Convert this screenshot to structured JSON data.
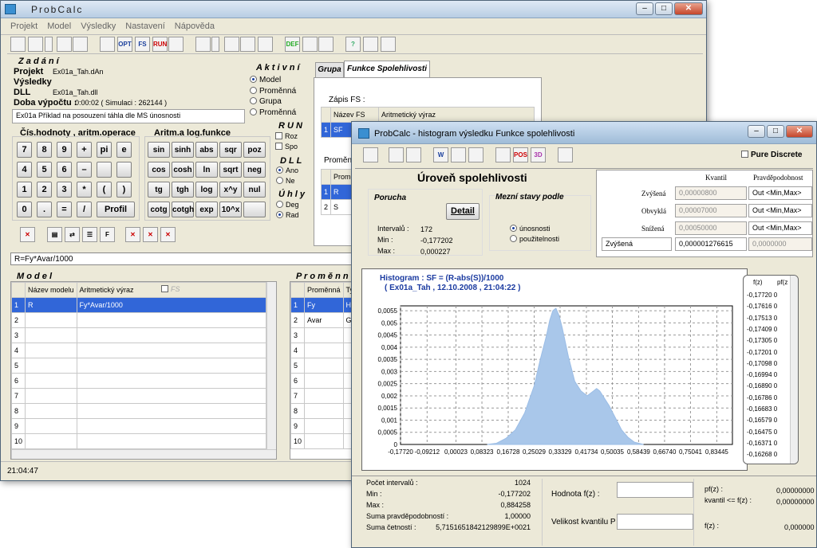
{
  "main": {
    "title": "ProbCalc",
    "menu": [
      "Projekt",
      "Model",
      "Výsledky",
      "Nastavení",
      "Nápověda"
    ],
    "toolbar": [
      "",
      "",
      "",
      "",
      "",
      "",
      "OPT",
      "FS",
      "RUN",
      "",
      "",
      "",
      "",
      "",
      "",
      "DEF",
      "",
      "",
      "?",
      ""
    ],
    "zadani": {
      "heading": "Z a d á n í",
      "projekt_l": "Projekt",
      "projekt_v": "Ex01a_Tah.dAn",
      "vysledky_l": "Výsledky",
      "dll_l": "DLL",
      "dll_v": "Ex01a_Tah.dll",
      "doba_l": "Doba výpočtu :",
      "doba_v": "0:00:02  ( Simulaci : 262144 )",
      "desc": "Ex01a Příklad na posouzení táhla dle MS únosnosti"
    },
    "aktivni": {
      "heading": "A k t i v n í",
      "items": [
        "Model",
        "Proměnná",
        "Grupa",
        "Proměnná"
      ]
    },
    "run": {
      "heading": "R U N",
      "items": [
        "Roz",
        "Spo"
      ]
    },
    "dll": {
      "heading": "D L L",
      "items": [
        "Ano",
        "Ne"
      ]
    },
    "uhly": {
      "heading": "Ú h l y",
      "items": [
        "Deg",
        "Rad"
      ]
    },
    "calc": {
      "heading1": "Čís.hodnoty , aritm.operace",
      "heading2": "Aritm.a log.funkce",
      "rows1": [
        [
          "7",
          "8",
          "9",
          "+",
          "pi",
          "e"
        ],
        [
          "4",
          "5",
          "6",
          "–",
          "",
          ""
        ],
        [
          "1",
          "2",
          "3",
          "*",
          "(",
          ")"
        ],
        [
          "0",
          ".",
          "=",
          "/",
          "Profil"
        ]
      ],
      "rows2": [
        [
          "sin",
          "sinh",
          "abs",
          "sqr",
          "poz"
        ],
        [
          "cos",
          "cosh",
          "ln",
          "sqrt",
          "neg"
        ],
        [
          "tg",
          "tgh",
          "log",
          "x^y",
          "nul"
        ],
        [
          "cotg",
          "cotgh",
          "exp",
          "10^x",
          ""
        ]
      ]
    },
    "formula": "R=Fy*Avar/1000",
    "model": {
      "heading": "M o d e l",
      "cols": [
        "Název modelu",
        "Aritmetický výraz",
        "FS"
      ],
      "rows": [
        [
          "1",
          "R",
          "Fy*Avar/1000"
        ],
        [
          "2",
          "",
          ""
        ],
        [
          "3",
          "",
          ""
        ],
        [
          "4",
          "",
          ""
        ],
        [
          "5",
          "",
          ""
        ],
        [
          "6",
          "",
          ""
        ],
        [
          "7",
          "",
          ""
        ],
        [
          "8",
          "",
          ""
        ],
        [
          "9",
          "",
          ""
        ],
        [
          "10",
          "",
          ""
        ]
      ]
    },
    "promenne": {
      "heading": "P r o m ě n n é",
      "cols": [
        "Proměnná",
        "Typ"
      ],
      "rows": [
        [
          "1",
          "Fy",
          "Histogr"
        ],
        [
          "2",
          "Avar",
          "Grupa"
        ],
        [
          "3",
          "",
          ""
        ],
        [
          "4",
          "",
          ""
        ],
        [
          "5",
          "",
          ""
        ],
        [
          "6",
          "",
          ""
        ],
        [
          "7",
          "",
          ""
        ],
        [
          "8",
          "",
          ""
        ],
        [
          "9",
          "",
          ""
        ],
        [
          "10",
          "",
          ""
        ]
      ]
    },
    "tabs": [
      "Grupa",
      "Funkce Spolehlivosti"
    ],
    "fs": {
      "zapis": "Zápis FS :",
      "cols": [
        "Název FS",
        "Aritmetický výraz"
      ],
      "row": [
        "1",
        "SF"
      ],
      "prom": "Proměnná",
      "prom_col": "Proměnná",
      "prom_rows": [
        [
          "1",
          "R"
        ],
        [
          "2",
          "S"
        ]
      ]
    },
    "status": "21:04:47"
  },
  "hist": {
    "title": "ProbCalc - histogram  výsledku Funkce spolehlivosti",
    "toolbar": [
      "",
      "",
      "",
      "",
      "W",
      "",
      "",
      "",
      "POS",
      "3D",
      ""
    ],
    "pure": "Pure Discrete",
    "heading": "Úroveň spolehlivosti",
    "porucha": "Porucha",
    "detail": "Detail",
    "int_l": "Intervalů :",
    "int_v": "172",
    "min_l": "Min :",
    "min_v": "-0,177202",
    "max_l": "Max :",
    "max_v": "0,000227",
    "mezni": "Mezní stavy podle",
    "mezni_items": [
      "únosnosti",
      "použitelnosti"
    ],
    "kv_head": [
      "Kvantil",
      "Pravděpodobnost"
    ],
    "kv_rows": [
      [
        "Zvýšená",
        "0,00000800",
        "Out <Min,Max>"
      ],
      [
        "Obvyklá",
        "0,00007000",
        "Out <Min,Max>"
      ],
      [
        "Snížená",
        "0,00050000",
        "Out <Min,Max>"
      ]
    ],
    "kv_last": [
      "Zvýšená",
      "0,000001276615",
      "0,0000000"
    ],
    "chart_data": {
      "type": "area",
      "title": "Histogram : SF = (R-abs(S))/1000",
      "subtitle": "( Ex01a_Tah , 12.10.2008 , 21:04:22 )",
      "y_ticks": [
        "0,0055",
        "0,005",
        "0,0045",
        "0,004",
        "0,0035",
        "0,003",
        "0,0025",
        "0,002",
        "0,0015",
        "0,001",
        "0,0005",
        "0"
      ],
      "x_ticks": [
        "-0,17720",
        "-0,09212",
        "0,00023",
        "0,08323",
        "0,16728",
        "0,25029",
        "0,33329",
        "0,41734",
        "0,50035",
        "0,58439",
        "0,66740",
        "0,75041",
        "0,83445"
      ],
      "xlim": [
        -0.1772,
        0.8845
      ],
      "ylim": [
        0,
        0.0057
      ],
      "grid": true,
      "x": [
        0.1,
        0.13,
        0.16,
        0.19,
        0.22,
        0.25,
        0.27,
        0.29,
        0.3,
        0.31,
        0.32,
        0.33,
        0.34,
        0.35,
        0.36,
        0.37,
        0.38,
        0.4,
        0.42,
        0.44,
        0.45,
        0.46,
        0.47,
        0.49,
        0.51,
        0.53,
        0.55,
        0.57,
        0.6
      ],
      "y": [
        0,
        5e-05,
        0.00025,
        0.0006,
        0.0013,
        0.0024,
        0.0035,
        0.0045,
        0.0051,
        0.0055,
        0.0056,
        0.0053,
        0.0048,
        0.0042,
        0.0036,
        0.0031,
        0.0026,
        0.0022,
        0.002,
        0.0022,
        0.0023,
        0.0022,
        0.002,
        0.0016,
        0.0011,
        0.0006,
        0.0003,
        0.0001,
        0
      ]
    },
    "fz_head": [
      "f(z)",
      "pf(z"
    ],
    "fz": [
      "-0,17720 0",
      "-0,17616 0",
      "-0,17513 0",
      "-0,17409 0",
      "-0,17305 0",
      "-0,17201 0",
      "-0,17098 0",
      "-0,16994 0",
      "-0,16890 0",
      "-0,16786 0",
      "-0,16683 0",
      "-0,16579 0",
      "-0,16475 0",
      "-0,16371 0",
      "-0,16268 0"
    ],
    "stats": [
      [
        "Počet intervalů :",
        "1024"
      ],
      [
        "Min :",
        "-0,177202"
      ],
      [
        "Max :",
        "0,884258"
      ],
      [
        "Suma pravděpodobností :",
        "1,00000"
      ],
      [
        "Suma četností :",
        "5,7151651842129899E+0021"
      ]
    ],
    "hodnota": "Hodnota f(z) :",
    "velikost": "Velikost kvantilu P :",
    "pfz": "pf(z) :",
    "pfz_v": "0,00000000",
    "kvantil": "kvantil <= f(z) :",
    "kvantil_v": "0,00000000",
    "fz_l": "f(z) :",
    "fz_v": "0,000000"
  }
}
